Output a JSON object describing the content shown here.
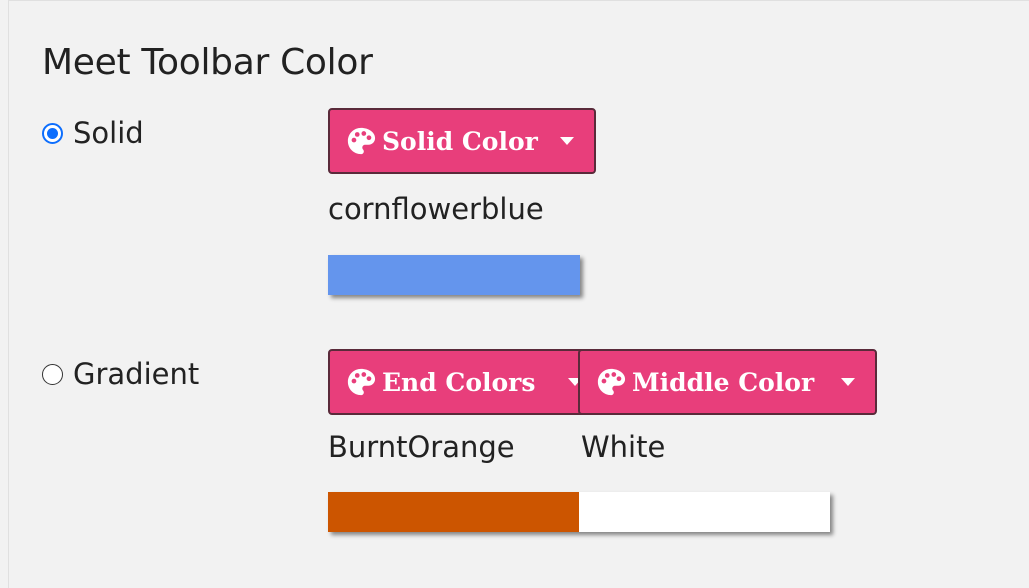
{
  "title": "Meet Toolbar Color",
  "solid": {
    "radio_label": "Solid",
    "selected": true,
    "button_label": "Solid Color",
    "color_name": "cornflowerblue",
    "color_hex": "#6495ed"
  },
  "gradient": {
    "radio_label": "Gradient",
    "selected": false,
    "end_button_label": "End Colors",
    "middle_button_label": "Middle Color",
    "end_color_name": "BurntOrange",
    "end_color_hex": "#cc5500",
    "middle_color_name": "White",
    "middle_color_hex": "#ffffff"
  },
  "colors": {
    "button_bg": "#e83e7b",
    "radio_accent": "#0d6efd"
  },
  "icons": {
    "button_icon": "palette-icon",
    "dropdown_icon": "caret-down-icon"
  }
}
